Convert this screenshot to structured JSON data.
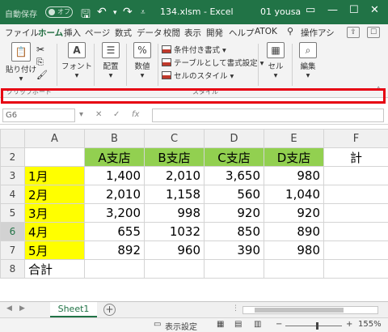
{
  "titlebar": {
    "autosave_label": "自動保存",
    "autosave_state": "オフ",
    "doc_title": "134.xlsm  -  Excel",
    "user": "01 yousa",
    "min": "—",
    "max": "☐",
    "close": "✕"
  },
  "ribbon_tabs": [
    "ファイル",
    "ホーム",
    "挿入",
    "ページ",
    "数式",
    "データ",
    "校閲",
    "表示",
    "開発",
    "ヘルプ",
    "ATOK",
    "操作アシ"
  ],
  "active_tab": "ホーム",
  "ribbon": {
    "paste": "貼り付け",
    "font": "フォント",
    "align": "配置",
    "number": "数値",
    "cond_format": "条件付き書式",
    "table_format": "テーブルとして書式設定",
    "cell_style": "セルのスタイル",
    "cells": "セル",
    "edit": "編集",
    "group_clipboard": "クリップボード",
    "group_style": "スタイル"
  },
  "formula_bar": {
    "name_box": "G6",
    "fx": "fx",
    "value": ""
  },
  "grid": {
    "columns": [
      "A",
      "B",
      "C",
      "D",
      "E",
      "F"
    ],
    "selected_column": "F",
    "selected_row": "6",
    "rows": [
      {
        "row": "2",
        "cells": [
          "",
          "A支店",
          "B支店",
          "C支店",
          "D支店",
          "計"
        ]
      },
      {
        "row": "3",
        "cells": [
          "1月",
          "1,400",
          "2,010",
          "3,650",
          "980",
          ""
        ]
      },
      {
        "row": "4",
        "cells": [
          "2月",
          "2,010",
          "1,158",
          "560",
          "1,040",
          ""
        ]
      },
      {
        "row": "5",
        "cells": [
          "3月",
          "3,200",
          "998",
          "920",
          "920",
          ""
        ]
      },
      {
        "row": "6",
        "cells": [
          "4月",
          "655",
          "1032",
          "850",
          "890",
          ""
        ]
      },
      {
        "row": "7",
        "cells": [
          "5月",
          "892",
          "960",
          "390",
          "980",
          ""
        ]
      },
      {
        "row": "8",
        "cells": [
          "合計",
          "",
          "",
          "",
          "",
          ""
        ]
      }
    ]
  },
  "sheets": {
    "active": "Sheet1",
    "add": "+"
  },
  "statusbar": {
    "display_settings": "表示設定",
    "zoom": "155%"
  }
}
